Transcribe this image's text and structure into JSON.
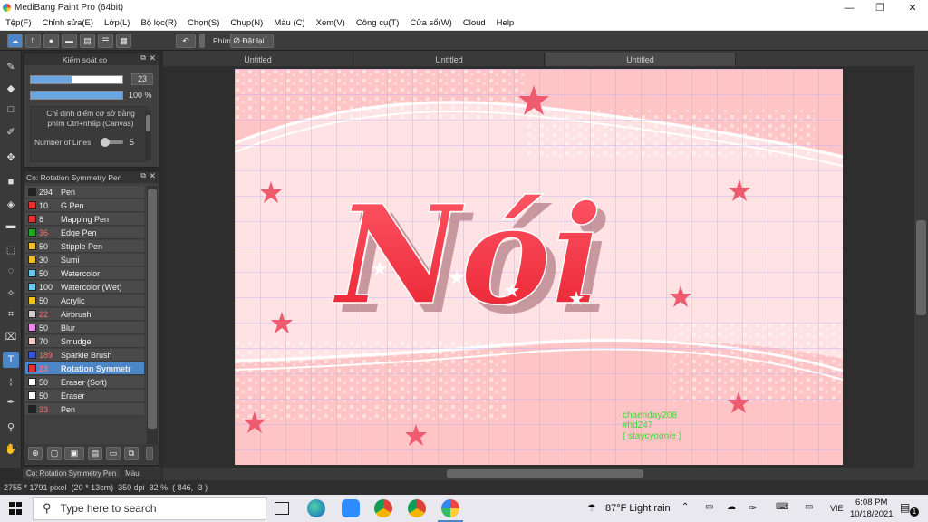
{
  "app": {
    "title": "MediBang Paint Pro (64bit)"
  },
  "menu": [
    "Tệp(F)",
    "Chỉnh sửa(E)",
    "Lớp(L)",
    "Bộ lọc(R)",
    "Chọn(S)",
    "Chụp(N)",
    "Màu (C)",
    "Xem(V)",
    "Công cụ(T)",
    "Cửa sổ(W)",
    "Cloud",
    "Help"
  ],
  "toolbar": {
    "phim_label": "Phím",
    "reset_label": "Đặt lại"
  },
  "brush_control": {
    "title": "Kiểm soát cọ",
    "size_value": "23",
    "opacity_value": "100 %",
    "size_fraction": 0.45,
    "opacity_fraction": 1.0,
    "hint": "Chỉ định điểm cơ sở bằng phím Ctrl+nhấp (Canvas)",
    "lines_label": "Number of Lines",
    "lines_value": "5"
  },
  "brush_list": {
    "title": "Cọ: Rotation Symmetry Pen",
    "items": [
      {
        "size": "294",
        "name": "Pen",
        "color": "#222222",
        "size_color": "#eeeeee"
      },
      {
        "size": "10",
        "name": "G Pen",
        "color": "#e83030",
        "size_color": "#eeeeee"
      },
      {
        "size": "8",
        "name": "Mapping Pen",
        "color": "#e83030",
        "size_color": "#eeeeee"
      },
      {
        "size": "36",
        "name": "Edge Pen",
        "color": "#22aa22",
        "size_color": "#ff7070"
      },
      {
        "size": "50",
        "name": "Stipple Pen",
        "color": "#f0c020",
        "size_color": "#eeeeee"
      },
      {
        "size": "30",
        "name": "Sumi",
        "color": "#f0c020",
        "size_color": "#eeeeee"
      },
      {
        "size": "50",
        "name": "Watercolor",
        "color": "#66ccee",
        "size_color": "#eeeeee"
      },
      {
        "size": "100",
        "name": "Watercolor (Wet)",
        "color": "#66ccee",
        "size_color": "#eeeeee"
      },
      {
        "size": "50",
        "name": "Acrylic",
        "color": "#f0c020",
        "size_color": "#eeeeee"
      },
      {
        "size": "22",
        "name": "Airbrush",
        "color": "#cccccc",
        "size_color": "#ff7070"
      },
      {
        "size": "50",
        "name": "Blur",
        "color": "#ee88ee",
        "size_color": "#eeeeee"
      },
      {
        "size": "70",
        "name": "Smudge",
        "color": "#f5cccc",
        "size_color": "#eeeeee"
      },
      {
        "size": "189",
        "name": "Sparkle Brush",
        "color": "#3355dd",
        "size_color": "#ff7070"
      },
      {
        "size": "23",
        "name": "Rotation Symmetr",
        "color": "#e83030",
        "size_color": "#ff7070"
      },
      {
        "size": "50",
        "name": "Eraser (Soft)",
        "color": "#ffffff",
        "size_color": "#eeeeee"
      },
      {
        "size": "50",
        "name": "Eraser",
        "color": "#ffffff",
        "size_color": "#eeeeee"
      },
      {
        "size": "33",
        "name": "Pen",
        "color": "#222222",
        "size_color": "#ff7070"
      }
    ]
  },
  "panel_tabs": {
    "brush": "Cọ: Rotation Symmetry Pen",
    "color": "Màu"
  },
  "tabs": [
    "Untitled",
    "Untitled",
    "Untitled"
  ],
  "canvas": {
    "main_text": "Nói",
    "sig1": "chaenday208",
    "sig2": "#hd247",
    "sig3": "( staycyoonie )"
  },
  "status": {
    "dims": "2755 * 1791 pixel",
    "cm": "(20 * 13cm)",
    "dpi": "350 dpi",
    "zoom": "32 %",
    "coords": "( 846, -3 )"
  },
  "taskbar": {
    "search_placeholder": "Type here to search",
    "weather": "87°F  Light rain",
    "lang": "VIE",
    "time": "6:08 PM",
    "date": "10/18/2021",
    "notif": "1"
  },
  "colors": {
    "accent": "#4a86c8",
    "canvas_bg": "#ffc9c9",
    "text_red": "#f0363f"
  }
}
